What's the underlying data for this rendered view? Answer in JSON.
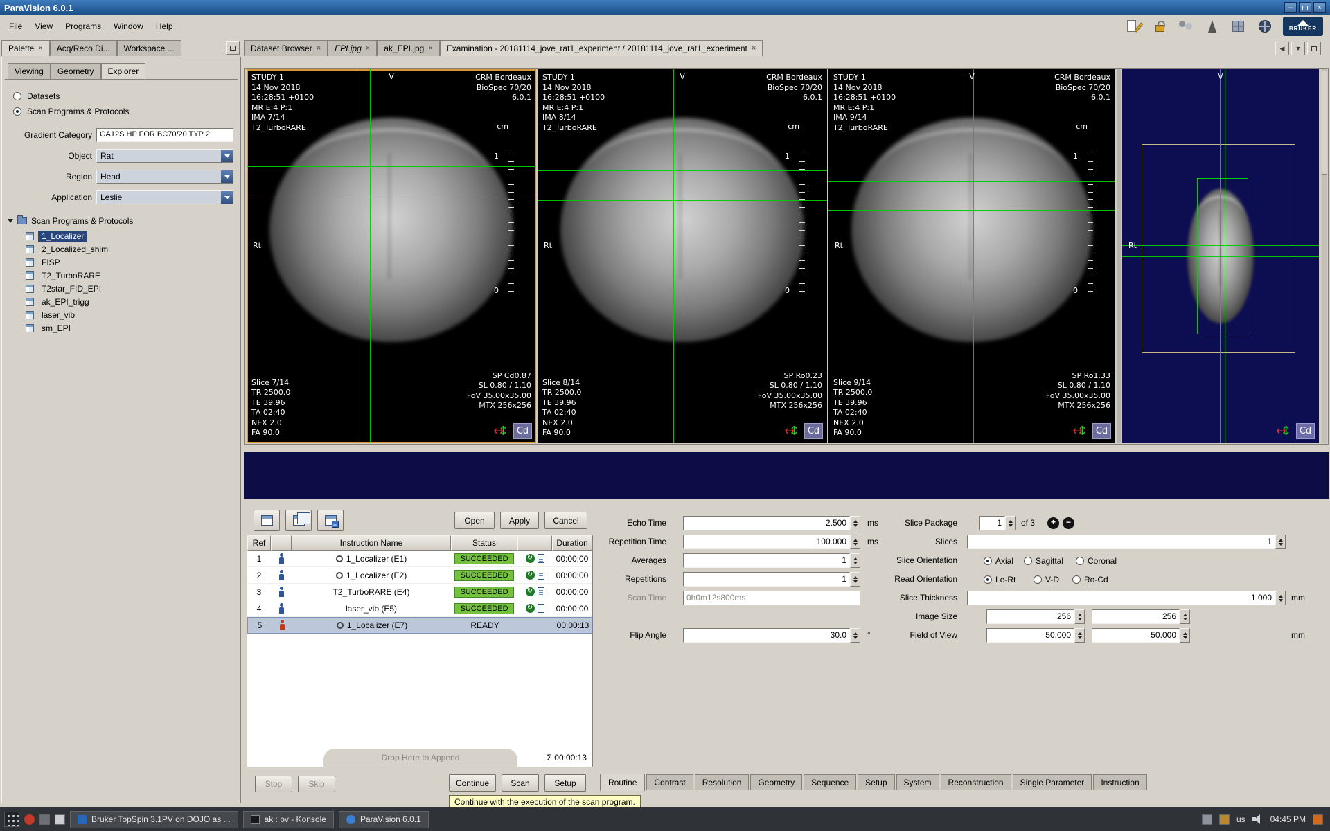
{
  "window": {
    "title": "ParaVision 6.0.1",
    "controls": {
      "minimize": "–",
      "close": "×"
    }
  },
  "menu": {
    "items": [
      "File",
      "View",
      "Programs",
      "Window",
      "Help"
    ]
  },
  "brand": "BRUKER",
  "icons": {
    "close": "×",
    "chevron_left": "◀",
    "chevron_down": "▼",
    "arrow_h": "↔",
    "arrow_v": "↕",
    "refresh": "↻",
    "plus": "+",
    "minus": "−"
  },
  "palette": {
    "dock_tabs": [
      {
        "label": "Palette"
      },
      {
        "label": "Acq/Reco Di..."
      },
      {
        "label": "Workspace ..."
      }
    ],
    "view_tabs": [
      "Viewing",
      "Geometry",
      "Explorer"
    ],
    "radio_datasets": "Datasets",
    "radio_scan": "Scan Programs & Protocols",
    "fields": {
      "gradient_category": {
        "label": "Gradient Category",
        "value": "GA12S HP FOR BC70/20 TYP 2"
      },
      "object": {
        "label": "Object",
        "value": "Rat"
      },
      "region": {
        "label": "Region",
        "value": "Head"
      },
      "application": {
        "label": "Application",
        "value": "Leslie"
      }
    },
    "tree": {
      "root": "Scan Programs & Protocols",
      "items": [
        "1_Localizer",
        "2_Localized_shim",
        "FISP",
        "T2_TurboRARE",
        "T2star_FID_EPI",
        "ak_EPI_trigg",
        "laser_vib",
        "sm_EPI"
      ]
    }
  },
  "main_tabs": [
    {
      "label": "Dataset Browser"
    },
    {
      "label": "EPI.jpg"
    },
    {
      "label": "ak_EPI.jpg"
    },
    {
      "label": "Examination - 20181114_jove_rat1_experiment / 20181114_jove_rat1_experiment"
    }
  ],
  "viewports": [
    {
      "info": [
        "STUDY 1",
        "14 Nov 2018",
        "16:28:51 +0100",
        "MR E:4 P:1",
        "IMA 7/14",
        "T2_TurboRARE"
      ],
      "site": [
        "CRM Bordeaux",
        "BioSpec 70/20",
        "6.0.1"
      ],
      "top": "V",
      "left": "Rt",
      "unit": "cm",
      "scale_hi": "1",
      "scale_lo": "0",
      "params": [
        "Slice 7/14",
        "TR 2500.0",
        "TE 39.96",
        "TA 02:40",
        "NEX 2.0",
        "FA 90.0"
      ],
      "geo": [
        "SP Cd0.87",
        "SL 0.80 / 1.10",
        "FoV 35.00x35.00",
        "MTX 256x256"
      ],
      "corner": "Cd"
    },
    {
      "info": [
        "STUDY 1",
        "14 Nov 2018",
        "16:28:51 +0100",
        "MR E:4 P:1",
        "IMA 8/14",
        "T2_TurboRARE"
      ],
      "site": [
        "CRM Bordeaux",
        "BioSpec 70/20",
        "6.0.1"
      ],
      "top": "V",
      "left": "Rt",
      "unit": "cm",
      "scale_hi": "1",
      "scale_lo": "0",
      "params": [
        "Slice 8/14",
        "TR 2500.0",
        "TE 39.96",
        "TA 02:40",
        "NEX 2.0",
        "FA 90.0"
      ],
      "geo": [
        "SP Ro0.23",
        "SL 0.80 / 1.10",
        "FoV 35.00x35.00",
        "MTX 256x256"
      ],
      "corner": "Cd"
    },
    {
      "info": [
        "STUDY 1",
        "14 Nov 2018",
        "16:28:51 +0100",
        "MR E:4 P:1",
        "IMA 9/14",
        "T2_TurboRARE"
      ],
      "site": [
        "CRM Bordeaux",
        "BioSpec 70/20",
        "6.0.1"
      ],
      "top": "V",
      "left": "Rt",
      "unit": "cm",
      "scale_hi": "1",
      "scale_lo": "0",
      "params": [
        "Slice 9/14",
        "TR 2500.0",
        "TE 39.96",
        "TA 02:40",
        "NEX 2.0",
        "FA 90.0"
      ],
      "geo": [
        "SP Ro1.33",
        "SL 0.80 / 1.10",
        "FoV 35.00x35.00",
        "MTX 256x256"
      ],
      "corner": "Cd"
    }
  ],
  "mini_viewport": {
    "top": "V",
    "left": "Rt",
    "corner": "Cd"
  },
  "scan_control": {
    "open": "Open",
    "apply": "Apply",
    "cancel": "Cancel",
    "table": {
      "headers": {
        "ref": "Ref",
        "name": "Instruction Name",
        "status": "Status",
        "duration": "Duration"
      },
      "rows": [
        {
          "ref": "1",
          "name": "1_Localizer (E1)",
          "status": "SUCCEEDED",
          "duration": "00:00:00"
        },
        {
          "ref": "2",
          "name": "1_Localizer (E2)",
          "status": "SUCCEEDED",
          "duration": "00:00:00"
        },
        {
          "ref": "3",
          "name": "T2_TurboRARE (E4)",
          "status": "SUCCEEDED",
          "duration": "00:00:00"
        },
        {
          "ref": "4",
          "name": "laser_vib (E5)",
          "status": "SUCCEEDED",
          "duration": "00:00:00"
        },
        {
          "ref": "5",
          "name": "1_Localizer (E7)",
          "status": "READY",
          "duration": "00:00:13"
        }
      ]
    },
    "drop_hint": "Drop Here to Append",
    "total": "Σ 00:00:13",
    "stop": "Stop",
    "skip": "Skip",
    "continue": "Continue",
    "scan": "Scan",
    "setup": "Setup",
    "tooltip": "Continue with the execution of the scan program."
  },
  "parameters": {
    "echo_time": {
      "label": "Echo Time",
      "value": "2.500",
      "unit": "ms"
    },
    "repetition_time": {
      "label": "Repetition Time",
      "value": "100.000",
      "unit": "ms"
    },
    "averages": {
      "label": "Averages",
      "value": "1"
    },
    "repetitions": {
      "label": "Repetitions",
      "value": "1"
    },
    "scan_time": {
      "label": "Scan Time",
      "value": "0h0m12s800ms"
    },
    "flip_angle": {
      "label": "Flip Angle",
      "value": "30.0",
      "unit": "°"
    },
    "slice_package": {
      "label": "Slice Package",
      "value": "1",
      "of": "of 3"
    },
    "slices": {
      "label": "Slices",
      "value": "1"
    },
    "slice_orientation": {
      "label": "Slice Orientation",
      "options": [
        "Axial",
        "Sagittal",
        "Coronal"
      ],
      "selected": "Axial"
    },
    "read_orientation": {
      "label": "Read Orientation",
      "options": [
        "Le-Rt",
        "V-D",
        "Ro-Cd"
      ],
      "selected": "Le-Rt"
    },
    "slice_thickness": {
      "label": "Slice Thickness",
      "value": "1.000",
      "unit": "mm"
    },
    "image_size": {
      "label": "Image Size",
      "value_1": "256",
      "value_2": "256"
    },
    "field_of_view": {
      "label": "Field of View",
      "value_1": "50.000",
      "value_2": "50.000",
      "unit": "mm"
    }
  },
  "param_tabs": [
    "Routine",
    "Contrast",
    "Resolution",
    "Geometry",
    "Sequence",
    "Setup",
    "System",
    "Reconstruction",
    "Single Parameter",
    "Instruction"
  ],
  "taskbar": {
    "tasks": [
      "Bruker TopSpin 3.1PV on DOJO as ...",
      "ak : pv - Konsole",
      "ParaVision 6.0.1"
    ],
    "keyboard_layout": "us",
    "clock": "04:45 PM"
  }
}
